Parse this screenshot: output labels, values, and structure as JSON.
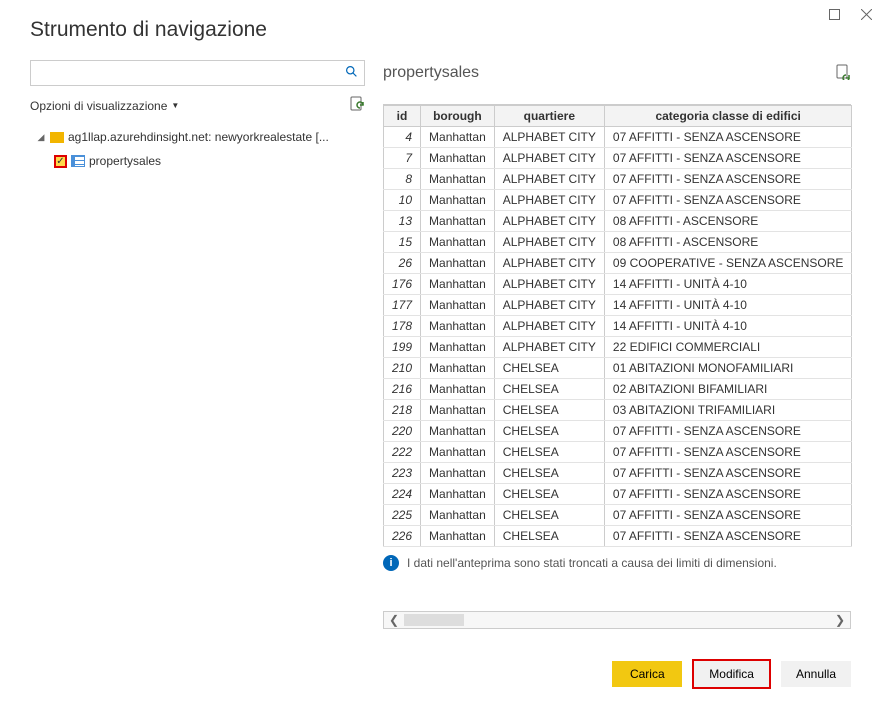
{
  "window": {
    "title": "Strumento di navigazione"
  },
  "search": {
    "placeholder": ""
  },
  "displayOptions": {
    "label": "Opzioni di visualizzazione"
  },
  "tree": {
    "root": {
      "label": "ag1llap.azurehdinsight.net: newyorkrealestate [..."
    },
    "child": {
      "label": "propertysales",
      "checked": true
    }
  },
  "preview": {
    "title": "propertysales",
    "columns": [
      "id",
      "borough",
      "quartiere",
      "categoria classe di edifici"
    ],
    "rows": [
      [
        "4",
        "Manhattan",
        "ALPHABET CITY",
        "07 AFFITTI - SENZA ASCENSORE"
      ],
      [
        "7",
        "Manhattan",
        "ALPHABET CITY",
        "07 AFFITTI - SENZA ASCENSORE"
      ],
      [
        "8",
        "Manhattan",
        "ALPHABET CITY",
        "07 AFFITTI - SENZA ASCENSORE"
      ],
      [
        "10",
        "Manhattan",
        "ALPHABET CITY",
        "07 AFFITTI - SENZA ASCENSORE"
      ],
      [
        "13",
        "Manhattan",
        "ALPHABET CITY",
        "08 AFFITTI - ASCENSORE"
      ],
      [
        "15",
        "Manhattan",
        "ALPHABET CITY",
        "08 AFFITTI - ASCENSORE"
      ],
      [
        "26",
        "Manhattan",
        "ALPHABET CITY",
        "09 COOPERATIVE - SENZA ASCENSORE"
      ],
      [
        "176",
        "Manhattan",
        "ALPHABET CITY",
        "14 AFFITTI - UNITÀ 4-10"
      ],
      [
        "177",
        "Manhattan",
        "ALPHABET CITY",
        "14 AFFITTI - UNITÀ 4-10"
      ],
      [
        "178",
        "Manhattan",
        "ALPHABET CITY",
        "14 AFFITTI - UNITÀ 4-10"
      ],
      [
        "199",
        "Manhattan",
        "ALPHABET CITY",
        "22 EDIFICI COMMERCIALI"
      ],
      [
        "210",
        "Manhattan",
        "CHELSEA",
        "01 ABITAZIONI MONOFAMILIARI"
      ],
      [
        "216",
        "Manhattan",
        "CHELSEA",
        "02 ABITAZIONI BIFAMILIARI"
      ],
      [
        "218",
        "Manhattan",
        "CHELSEA",
        "03 ABITAZIONI TRIFAMILIARI"
      ],
      [
        "220",
        "Manhattan",
        "CHELSEA",
        "07 AFFITTI - SENZA ASCENSORE"
      ],
      [
        "222",
        "Manhattan",
        "CHELSEA",
        "07 AFFITTI - SENZA ASCENSORE"
      ],
      [
        "223",
        "Manhattan",
        "CHELSEA",
        "07 AFFITTI - SENZA ASCENSORE"
      ],
      [
        "224",
        "Manhattan",
        "CHELSEA",
        "07 AFFITTI - SENZA ASCENSORE"
      ],
      [
        "225",
        "Manhattan",
        "CHELSEA",
        "07 AFFITTI - SENZA ASCENSORE"
      ],
      [
        "226",
        "Manhattan",
        "CHELSEA",
        "07 AFFITTI - SENZA ASCENSORE"
      ]
    ],
    "truncateMessage": "I dati nell'anteprima sono stati troncati a causa dei limiti di dimensioni."
  },
  "buttons": {
    "load": "Carica",
    "edit": "Modifica",
    "cancel": "Annulla"
  }
}
